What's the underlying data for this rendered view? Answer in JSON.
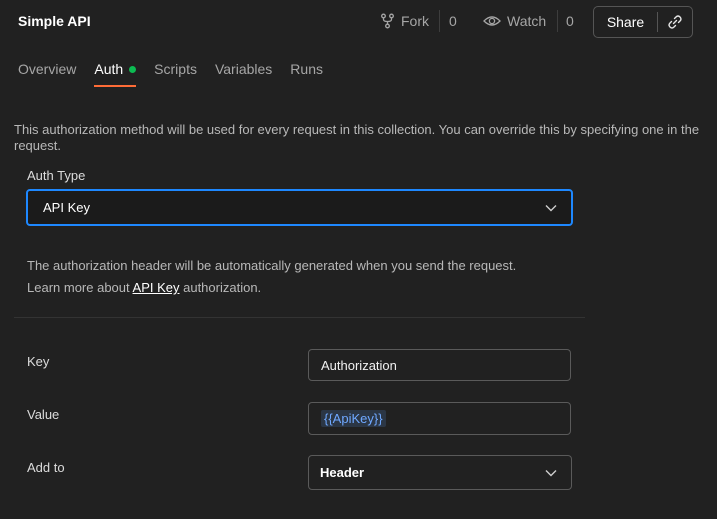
{
  "header": {
    "title": "Simple API",
    "fork_label": "Fork",
    "fork_count": "0",
    "watch_label": "Watch",
    "watch_count": "0",
    "share_label": "Share"
  },
  "tabs": [
    {
      "label": "Overview"
    },
    {
      "label": "Auth"
    },
    {
      "label": "Scripts"
    },
    {
      "label": "Variables"
    },
    {
      "label": "Runs"
    }
  ],
  "auth": {
    "description": "This authorization method will be used for every request in this collection. You can override this by specifying one in the request.",
    "type_label": "Auth Type",
    "type_value": "API Key",
    "info_line1": "The authorization header will be automatically generated when you send the request.",
    "info_prefix": "Learn more about ",
    "info_link": "API Key",
    "info_suffix": " authorization.",
    "key_label": "Key",
    "key_value": "Authorization",
    "value_label": "Value",
    "value_value": "{{ApiKey}}",
    "addto_label": "Add to",
    "addto_value": "Header"
  },
  "colors": {
    "accent": "#ff6c37",
    "focus": "#1e88ff",
    "status_dot": "#0cbb52"
  }
}
